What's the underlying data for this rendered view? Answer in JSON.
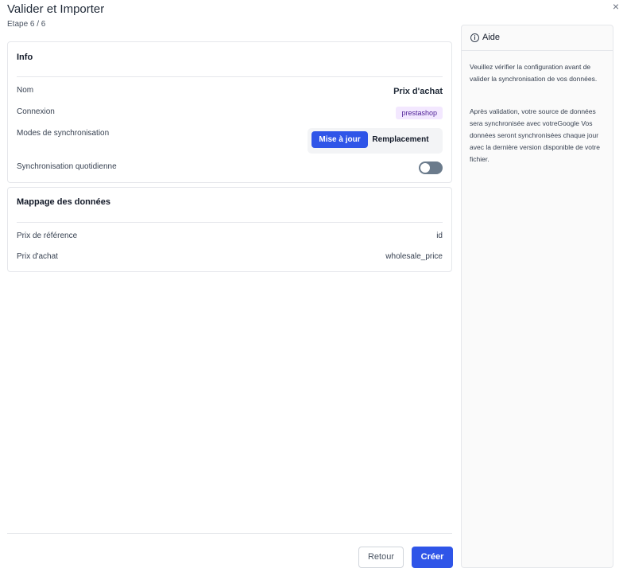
{
  "header": {
    "title": "Valider et Importer",
    "step": "Etape 6 / 6",
    "close_icon": "×"
  },
  "info": {
    "title": "Info",
    "rows": {
      "name_label": "Nom",
      "name_value": "Prix d'achat",
      "connection_label": "Connexion",
      "connection_value": "prestashop",
      "sync_modes_label": "Modes de synchronisation",
      "sync_modes_options": [
        "Mise à jour",
        "Remplacement"
      ],
      "sync_modes_selected": "Mise à jour",
      "daily_sync_label": "Synchronisation quotidienne",
      "daily_sync_enabled": false
    }
  },
  "mapping": {
    "title": "Mappage des données",
    "rows": [
      {
        "label": "Prix de référence",
        "value": "id"
      },
      {
        "label": "Prix d'achat",
        "value": "wholesale_price"
      }
    ]
  },
  "footer": {
    "back_label": "Retour",
    "create_label": "Créer"
  },
  "help": {
    "title": "Aide",
    "icon": "info-icon",
    "paragraph1": "Veuillez vérifier la configuration avant de valider la synchronisation de vos données.",
    "paragraph2": "Après validation, votre source de données sera synchronisée avec votreGoogle Vos données seront synchronisées chaque jour avec la dernière version disponible de votre fichier."
  },
  "colors": {
    "primary": "#2f55e8",
    "badge_bg": "#f3e8ff",
    "toggle_off": "#6b7b8c"
  }
}
